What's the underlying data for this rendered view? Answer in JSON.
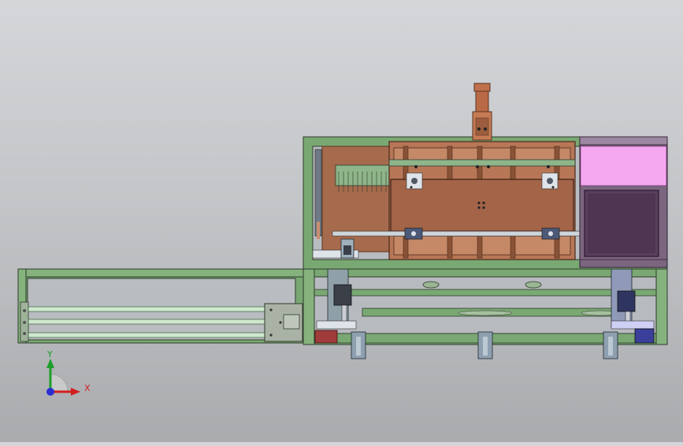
{
  "viewport": {
    "background_top": "#d4d6d9",
    "background_bottom": "#a9abae"
  },
  "model_colors": {
    "frame_green": "#7aa872",
    "frame_dark": "#2e3b2c",
    "copper": "#a66a4c",
    "copper_dark": "#7a4a33",
    "pink_panel": "#f5a8f0",
    "purple_panel": "#5a3f5c",
    "rail_green": "#cfe8cf",
    "slate": "#9aa7b4"
  },
  "triad": {
    "x_label": "X",
    "y_label": "Y",
    "icon": "coordinate-triad-icon"
  }
}
